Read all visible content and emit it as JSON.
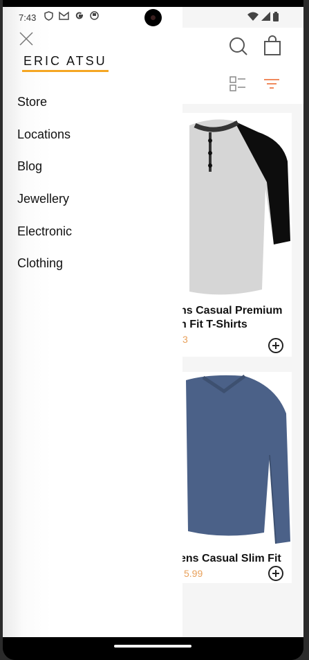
{
  "status_bar": {
    "time": "7:43",
    "icons": [
      "shield-icon",
      "gmail-icon",
      "google-icon",
      "app-icon"
    ],
    "right_icons": [
      "wifi-icon",
      "signal-icon",
      "battery-icon"
    ]
  },
  "drawer": {
    "brand": "ERIC ATSU",
    "accent_color": "#f5a623",
    "menu": [
      {
        "label": "Store"
      },
      {
        "label": "Locations"
      },
      {
        "label": "Blog"
      },
      {
        "label": "Jewellery"
      },
      {
        "label": "Electronic"
      },
      {
        "label": "Clothing"
      }
    ]
  },
  "header": {
    "icons": [
      "search-icon",
      "shopping-bag-icon",
      "list-view-icon",
      "filter-icon"
    ],
    "filter_color": "#f08a5d"
  },
  "products": [
    {
      "title_line1": "ns Casual Premium",
      "title_line2": "n Fit T-Shirts",
      "price": "3"
    },
    {
      "title_line1": "ens Casual Slim Fit",
      "title_line2": "",
      "price": "5.99"
    }
  ]
}
